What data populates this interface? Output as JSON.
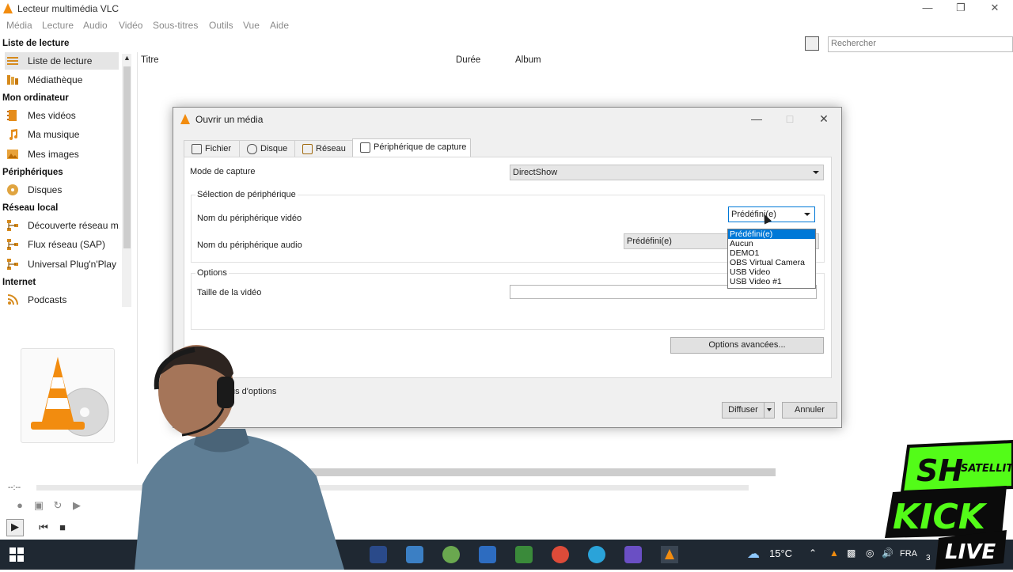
{
  "window": {
    "title": "Lecteur multimédia VLC",
    "menu": [
      "Média",
      "Lecture",
      "Audio",
      "Vidéo",
      "Sous-titres",
      "Outils",
      "Vue",
      "Aide"
    ]
  },
  "sidebar": {
    "sections": [
      {
        "header": "Liste de lecture",
        "items": [
          {
            "label": "Liste de lecture",
            "icon": "playlist-icon",
            "selected": true
          },
          {
            "label": "Médiathèque",
            "icon": "library-icon"
          }
        ]
      },
      {
        "header": "Mon ordinateur",
        "items": [
          {
            "label": "Mes vidéos",
            "icon": "film-icon"
          },
          {
            "label": "Ma musique",
            "icon": "music-note-icon"
          },
          {
            "label": "Mes images",
            "icon": "image-icon"
          }
        ]
      },
      {
        "header": "Périphériques",
        "items": [
          {
            "label": "Disques",
            "icon": "disc-icon"
          }
        ]
      },
      {
        "header": "Réseau local",
        "items": [
          {
            "label": "Découverte réseau m...",
            "icon": "network-icon"
          },
          {
            "label": "Flux réseau (SAP)",
            "icon": "network-icon"
          },
          {
            "label": "Universal Plug'n'Play",
            "icon": "network-icon"
          }
        ]
      },
      {
        "header": "Internet",
        "items": [
          {
            "label": "Podcasts",
            "icon": "podcast-icon"
          }
        ]
      }
    ]
  },
  "search": {
    "placeholder": "Rechercher"
  },
  "playlist": {
    "columns": [
      "Titre",
      "Durée",
      "Album"
    ]
  },
  "player": {
    "time": "--:--"
  },
  "dialog": {
    "title": "Ouvrir un média",
    "tabs": [
      {
        "label": "Fichier",
        "icon": "file-icon"
      },
      {
        "label": "Disque",
        "icon": "disc-icon"
      },
      {
        "label": "Réseau",
        "icon": "network-icon"
      },
      {
        "label": "Périphérique de capture",
        "icon": "capture-icon",
        "active": true
      }
    ],
    "capture_mode_label": "Mode de capture",
    "capture_mode_value": "DirectShow",
    "device_group_label": "Sélection de périphérique",
    "video_device_label": "Nom du périphérique vidéo",
    "video_device_value": "Prédéfini(e)",
    "audio_device_label": "Nom du périphérique audio",
    "audio_device_value": "Prédéfini(e)",
    "video_device_options": [
      "Prédéfini(e)",
      "Aucun",
      "DEMO1",
      "OBS Virtual Camera",
      "USB Video",
      "USB Video #1"
    ],
    "selected_option_index": 0,
    "options_group_label": "Options",
    "video_size_label": "Taille de la vidéo",
    "advanced_button": "Options avancées...",
    "more_options_text": "us d'options",
    "stream_button": "Diffuser",
    "cancel_button": "Annuler"
  },
  "taskbar": {
    "temperature": "15°C",
    "language": "FRA",
    "clock_partial": "3"
  },
  "overlay": {
    "logo_line1": "SH",
    "logo_line2": "SATELLITE",
    "logo_line3": "KICK",
    "logo_line4": "LIVE"
  },
  "colors": {
    "vlc_orange": "#f28c0f",
    "selection_blue": "#0078d7",
    "kick_green": "#53fc18",
    "taskbar": "#1f2832"
  }
}
